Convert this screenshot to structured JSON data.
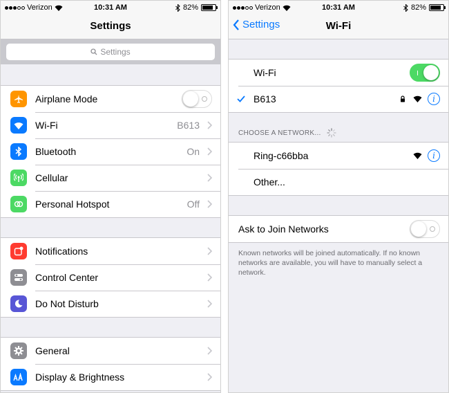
{
  "left": {
    "status": {
      "carrier": "Verizon",
      "time": "10:31 AM",
      "battery": "82%"
    },
    "nav_title": "Settings",
    "search_placeholder": "Settings",
    "groups": [
      [
        {
          "label": "Airplane Mode",
          "icon": "airplane-icon",
          "color": "#ff9500",
          "toggle": "off"
        },
        {
          "label": "Wi-Fi",
          "icon": "wifi-icon",
          "color": "#0a7aff",
          "detail": "B613"
        },
        {
          "label": "Bluetooth",
          "icon": "bluetooth-icon",
          "color": "#0a7aff",
          "detail": "On"
        },
        {
          "label": "Cellular",
          "icon": "cellular-icon",
          "color": "#4cd964"
        },
        {
          "label": "Personal Hotspot",
          "icon": "hotspot-icon",
          "color": "#4cd964",
          "detail": "Off"
        }
      ],
      [
        {
          "label": "Notifications",
          "icon": "notifications-icon",
          "color": "#ff3b30"
        },
        {
          "label": "Control Center",
          "icon": "control-center-icon",
          "color": "#8e8e93"
        },
        {
          "label": "Do Not Disturb",
          "icon": "moon-icon",
          "color": "#5856d6"
        }
      ],
      [
        {
          "label": "General",
          "icon": "gear-icon",
          "color": "#8e8e93"
        },
        {
          "label": "Display & Brightness",
          "icon": "display-icon",
          "color": "#0a7aff"
        }
      ]
    ]
  },
  "right": {
    "status": {
      "carrier": "Verizon",
      "time": "10:31 AM",
      "battery": "82%"
    },
    "nav_title": "Wi-Fi",
    "back_label": "Settings",
    "wifi_toggle": {
      "label": "Wi-Fi",
      "state": "on"
    },
    "connected_network": "B613",
    "choose_header": "CHOOSE A NETWORK...",
    "networks": [
      {
        "name": "Ring-c66bba"
      },
      {
        "name": "Other..."
      }
    ],
    "ask_to_join": {
      "label": "Ask to Join Networks",
      "state": "off"
    },
    "footer_note": "Known networks will be joined automatically. If no known networks are available, you will have to manually select a network.",
    "info_glyph": "i"
  },
  "colors": {
    "accent": "#0a7aff",
    "toggle_on": "#4cd964"
  }
}
